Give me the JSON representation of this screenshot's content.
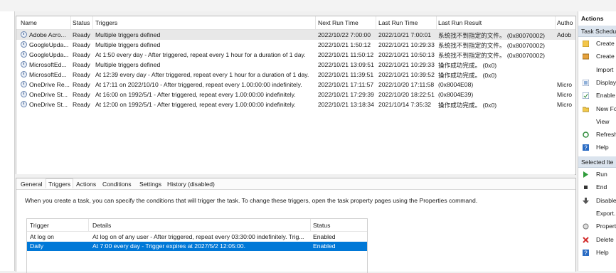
{
  "task_table": {
    "columns": [
      "Name",
      "Status",
      "Triggers",
      "Next Run Time",
      "Last Run Time",
      "Last Run Result",
      "Autho"
    ],
    "rows": [
      {
        "name": "Adobe Acro...",
        "status": "Ready",
        "triggers": "Multiple triggers defined",
        "next": "2022/10/22 7:00:00",
        "last": "2022/10/21 7:00:01",
        "result": "系统找不到指定的文件。 (0x80070002)",
        "author": "Adob"
      },
      {
        "name": "GoogleUpda...",
        "status": "Ready",
        "triggers": "Multiple triggers defined",
        "next": "2022/10/21 1:50:12",
        "last": "2022/10/21 10:29:33",
        "result": "系统找不到指定的文件。 (0x80070002)",
        "author": ""
      },
      {
        "name": "GoogleUpda...",
        "status": "Ready",
        "triggers": "At 1:50 every day - After triggered, repeat every 1 hour for a duration of 1 day.",
        "next": "2022/10/21 11:50:12",
        "last": "2022/10/21 10:50:13",
        "result": "系统找不到指定的文件。 (0x80070002)",
        "author": ""
      },
      {
        "name": "MicrosoftEd...",
        "status": "Ready",
        "triggers": "Multiple triggers defined",
        "next": "2022/10/21 13:09:51",
        "last": "2022/10/21 10:29:33",
        "result": "操作成功完成。 (0x0)",
        "author": ""
      },
      {
        "name": "MicrosoftEd...",
        "status": "Ready",
        "triggers": "At 12:39 every day - After triggered, repeat every 1 hour for a duration of 1 day.",
        "next": "2022/10/21 11:39:51",
        "last": "2022/10/21 10:39:52",
        "result": "操作成功完成。 (0x0)",
        "author": ""
      },
      {
        "name": "OneDrive Re...",
        "status": "Ready",
        "triggers": "At 17:11 on 2022/10/10 - After triggered, repeat every 1.00:00:00 indefinitely.",
        "next": "2022/10/21 17:11:57",
        "last": "2022/10/20 17:11:58",
        "result": "(0x8004E08)",
        "author": "Micro"
      },
      {
        "name": "OneDrive St...",
        "status": "Ready",
        "triggers": "At 16:00 on 1992/5/1 - After triggered, repeat every 1.00:00:00 indefinitely.",
        "next": "2022/10/21 17:29:39",
        "last": "2022/10/20 18:22:51",
        "result": "(0x8004E39)",
        "author": "Micro"
      },
      {
        "name": "OneDrive St...",
        "status": "Ready",
        "triggers": "At 12:00 on 1992/5/1 - After triggered, repeat every 1.00:00:00 indefinitely.",
        "next": "2022/10/21 13:18:34",
        "last": "2021/10/14 7:35:32",
        "result": "操作成功完成。 (0x0)",
        "author": "Micro"
      }
    ]
  },
  "tabs": [
    "General",
    "Triggers",
    "Actions",
    "Conditions",
    "Settings",
    "History (disabled)"
  ],
  "active_tab": "Triggers",
  "triggers_description": "When you create a task, you can specify the conditions that will trigger the task.  To change these triggers, open the task property pages using the Properties command.",
  "triggers_table": {
    "columns": [
      "Trigger",
      "Details",
      "Status"
    ],
    "rows": [
      {
        "trigger": "At log on",
        "details": "At log on of any user - After triggered, repeat every 03:30:00 indefinitely. Trig...",
        "status": "Enabled"
      },
      {
        "trigger": "Daily",
        "details": "At 7:00 every day - Trigger expires at 2027/5/2 12:05:00.",
        "status": "Enabled"
      }
    ]
  },
  "actions_pane": {
    "title": "Actions",
    "section1": "Task Schedu",
    "items1": [
      {
        "icon": "create-basic-task-icon",
        "label": "Create"
      },
      {
        "icon": "create-task-icon",
        "label": "Create"
      },
      {
        "icon": "",
        "label": "Import"
      },
      {
        "icon": "display-running-icon",
        "label": "Display"
      },
      {
        "icon": "enable-history-icon",
        "label": "Enable"
      },
      {
        "icon": "new-folder-icon",
        "label": "New Fo"
      },
      {
        "icon": "",
        "label": "View"
      },
      {
        "icon": "refresh-icon",
        "label": "Refresh"
      },
      {
        "icon": "help-icon",
        "label": "Help"
      }
    ],
    "section2": "Selected Ite",
    "items2": [
      {
        "icon": "run-icon",
        "label": "Run"
      },
      {
        "icon": "end-icon",
        "label": "End"
      },
      {
        "icon": "disable-icon",
        "label": "Disable"
      },
      {
        "icon": "",
        "label": "Export."
      },
      {
        "icon": "properties-icon",
        "label": "Propert"
      },
      {
        "icon": "delete-icon",
        "label": "Delete"
      },
      {
        "icon": "help-icon",
        "label": "Help"
      }
    ]
  },
  "colors": {
    "selection": "#0078d7",
    "section_header": "#dbe4ee"
  }
}
